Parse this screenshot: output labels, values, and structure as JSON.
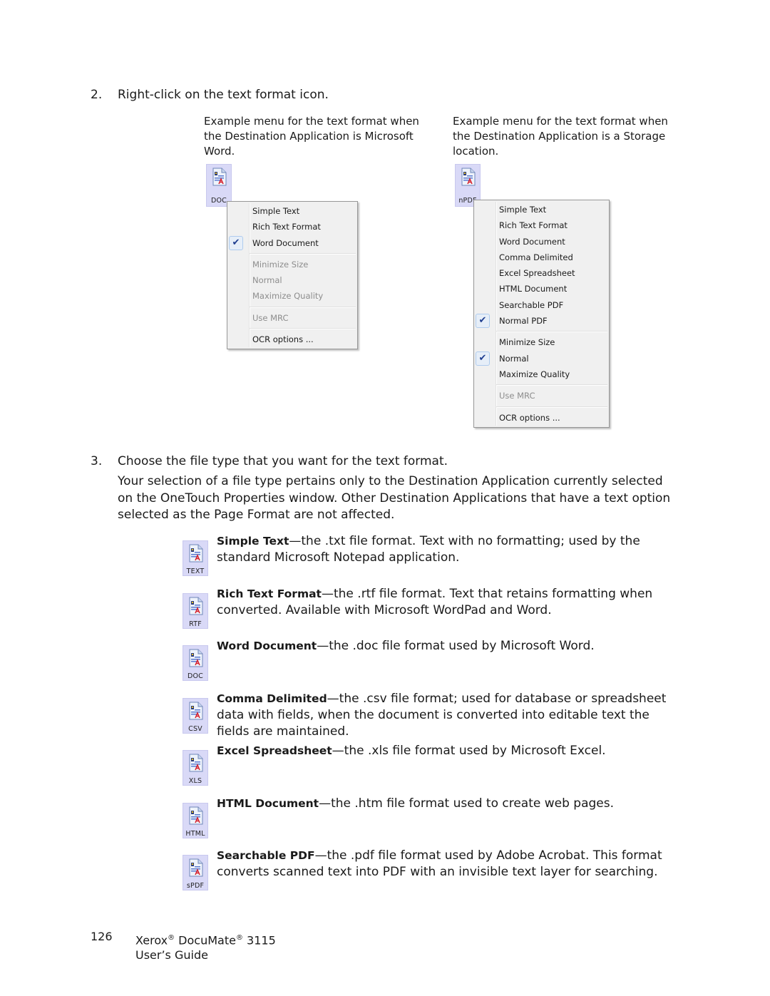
{
  "step2": {
    "number": "2.",
    "text": "Right-click on the text format icon."
  },
  "examples": [
    {
      "caption": "Example menu for the text format when the Destination Application is Microsoft Word.",
      "icon_label": "DOC",
      "menu": [
        {
          "label": "Simple Text",
          "enabled": true,
          "checked": false
        },
        {
          "label": "Rich Text Format",
          "enabled": true,
          "checked": false
        },
        {
          "label": "Word Document",
          "enabled": true,
          "checked": true
        },
        {
          "separator": true
        },
        {
          "label": "Minimize Size",
          "enabled": false,
          "checked": false
        },
        {
          "label": "Normal",
          "enabled": false,
          "checked": false
        },
        {
          "label": "Maximize Quality",
          "enabled": false,
          "checked": false
        },
        {
          "separator": true
        },
        {
          "label": "Use MRC",
          "enabled": false,
          "checked": false
        },
        {
          "separator": true
        },
        {
          "label": "OCR options ...",
          "enabled": true,
          "checked": false
        }
      ]
    },
    {
      "caption": "Example menu for the text format when the Destination Application is a Storage location.",
      "icon_label": "nPDF",
      "menu": [
        {
          "label": "Simple Text",
          "enabled": true,
          "checked": false
        },
        {
          "label": "Rich Text Format",
          "enabled": true,
          "checked": false
        },
        {
          "label": "Word Document",
          "enabled": true,
          "checked": false
        },
        {
          "label": "Comma Delimited",
          "enabled": true,
          "checked": false
        },
        {
          "label": "Excel Spreadsheet",
          "enabled": true,
          "checked": false
        },
        {
          "label": "HTML Document",
          "enabled": true,
          "checked": false
        },
        {
          "label": "Searchable PDF",
          "enabled": true,
          "checked": false
        },
        {
          "label": "Normal PDF",
          "enabled": true,
          "checked": true
        },
        {
          "separator": true
        },
        {
          "label": "Minimize Size",
          "enabled": true,
          "checked": false
        },
        {
          "label": "Normal",
          "enabled": true,
          "checked": true
        },
        {
          "label": "Maximize Quality",
          "enabled": true,
          "checked": false
        },
        {
          "separator": true
        },
        {
          "label": "Use MRC",
          "enabled": false,
          "checked": false
        },
        {
          "separator": true
        },
        {
          "label": "OCR options ...",
          "enabled": true,
          "checked": false
        }
      ]
    }
  ],
  "step3": {
    "number": "3.",
    "text": "Choose the file type that you want for the text format.",
    "paragraph": "Your selection of a file type pertains only to the Destination Application currently selected on the OneTouch Properties window. Other Destination Applications that have a text option selected as the Page Format are not affected."
  },
  "formats": [
    {
      "icon_label": "TEXT",
      "name": "Simple Text",
      "description": "—the .txt file format. Text with no formatting; used by the standard Microsoft Notepad application."
    },
    {
      "icon_label": "RTF",
      "name": "Rich Text Format",
      "description": "—the .rtf file format. Text that retains formatting when converted. Available with Microsoft WordPad and Word."
    },
    {
      "icon_label": "DOC",
      "name": "Word Document",
      "description": "—the .doc file format used by Microsoft Word."
    },
    {
      "icon_label": "CSV",
      "name": "Comma Delimited",
      "description": "—the .csv file format; used for database or spreadsheet data with fields, when the document is converted into editable text the fields are maintained."
    },
    {
      "icon_label": "XLS",
      "name": "Excel Spreadsheet",
      "description": "—the .xls file format used by Microsoft Excel."
    },
    {
      "icon_label": "HTML",
      "name": "HTML Document",
      "description": "—the .htm file format used to create web pages."
    },
    {
      "icon_label": "sPDF",
      "name": "Searchable PDF",
      "description": "—the .pdf file format used by Adobe Acrobat. This format converts scanned text into PDF with an invisible text layer for searching."
    }
  ],
  "footer": {
    "page_number": "126",
    "brand": "Xerox",
    "product": "DocuMate",
    "model": "3115",
    "registered": "®",
    "guide": "User’s Guide"
  },
  "colors": {
    "icon_highlight": "#d9d9f7",
    "menu_background": "#f0f0f0",
    "check_color": "#1e3d8f"
  }
}
